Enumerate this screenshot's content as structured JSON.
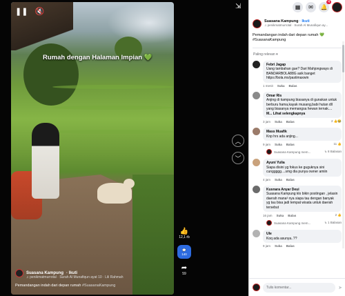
{
  "video": {
    "overlay_text": "Rumah dengan Halaman Impian",
    "overlay_emoji": "💚",
    "author": "Suasana Kampung",
    "follow": "· Ikuti",
    "music": "♫ penikmatmurrotal · Surah Al Munafiqun ayat 10 · Lili Rahmah",
    "caption": "Pemandangan indah dari depan rumah",
    "caption_tag": "#SuasanaKampung",
    "likes": "12,1 rb",
    "comments": "140",
    "shares": "59"
  },
  "top_bar": {
    "notif_count": "4",
    "icons": [
      "menu-grid-icon",
      "messenger-icon",
      "bell-icon",
      "profile-avatar"
    ]
  },
  "post": {
    "author": "Suasana Kampung",
    "follow": "· Ikuti",
    "music": "♫ penikmatmurrotal · Surah Al Munafiqun ay...",
    "caption": "Pemandangan indah dari depan rumah",
    "caption_emoji": "💚",
    "caption_tag": "#SuasanaKampung"
  },
  "sort_label": "Paling relevan ▾",
  "comments": [
    {
      "author": "Febri Jagap",
      "text": "Uang tambahan gue? Dari Mahjongways di BANDARBOLA88G asik banget https://bola.mx/pastimaxwin",
      "time": "1 menit",
      "like": "Suka",
      "reply": "Balas",
      "reactions": ""
    },
    {
      "author": "Omar Ris",
      "text": "Anjing di kampung biasanya di gunakan untuk berburu hama,kayak musang,babi hutan dll yang biasanya memangsa hewan ternak....",
      "more": "M... Lihat selengkapnya",
      "time": "3 jam",
      "like": "Suka",
      "reply": "Balas",
      "reactions": "2 👍😂"
    },
    {
      "author": "Mass Muafik",
      "text": "Knp hrs ada anjing...",
      "time": "9 jam",
      "like": "Suka",
      "reply": "Balas",
      "reactions": "11 👍"
    },
    {
      "author": "Ayuni Yulia",
      "text": "Siapa disini yg fokus ke guguknya sini cunggggg....smg dia punya owner amiin",
      "time": "4 jam",
      "like": "Suka",
      "reply": "Balas",
      "reactions": ""
    },
    {
      "author": "Kusnara Anyar Deui",
      "text": "Suasana Kampung klo bikin postingan , jelasin daerah mana³ nya siapa tau dengan banyak yg tau bisa jadi tempat wisata untuk daerah tersebut",
      "time": "16 jam",
      "like": "Suka",
      "reply": "Balas",
      "reactions": "2 👍"
    },
    {
      "author": "Ule",
      "text": "Koq ada asunya..??",
      "time": "9 jam",
      "like": "Suka",
      "reply": "Balas",
      "reactions": ""
    }
  ],
  "reply_rows": [
    {
      "name": "Suasana Kampung mem...",
      "count": "↳ 8 Balasan"
    },
    {
      "name": "Suasana Kampung mem...",
      "count": "↳ 1 Balasan"
    }
  ],
  "write_placeholder": "Tulis komentar..."
}
